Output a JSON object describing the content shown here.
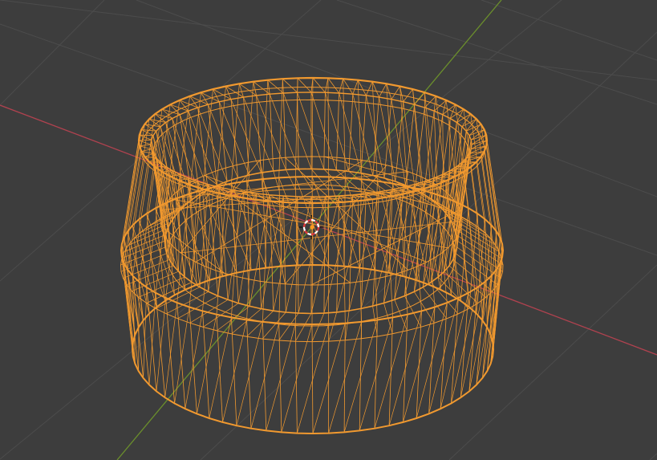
{
  "viewport": {
    "icons": {
      "cursor": "3d-cursor-icon",
      "origin": "object-origin-icon"
    },
    "colors": {
      "background": "#3d3d3d",
      "grid": "#4c4c4c",
      "x_axis": "#b0424f",
      "y_axis": "#6b8f2c",
      "selection_wire": "#f1992f",
      "cursor_ring_red": "#e0373c",
      "cursor_ring_white": "#ffffff",
      "origin_dot": "#ff9a1f"
    }
  }
}
